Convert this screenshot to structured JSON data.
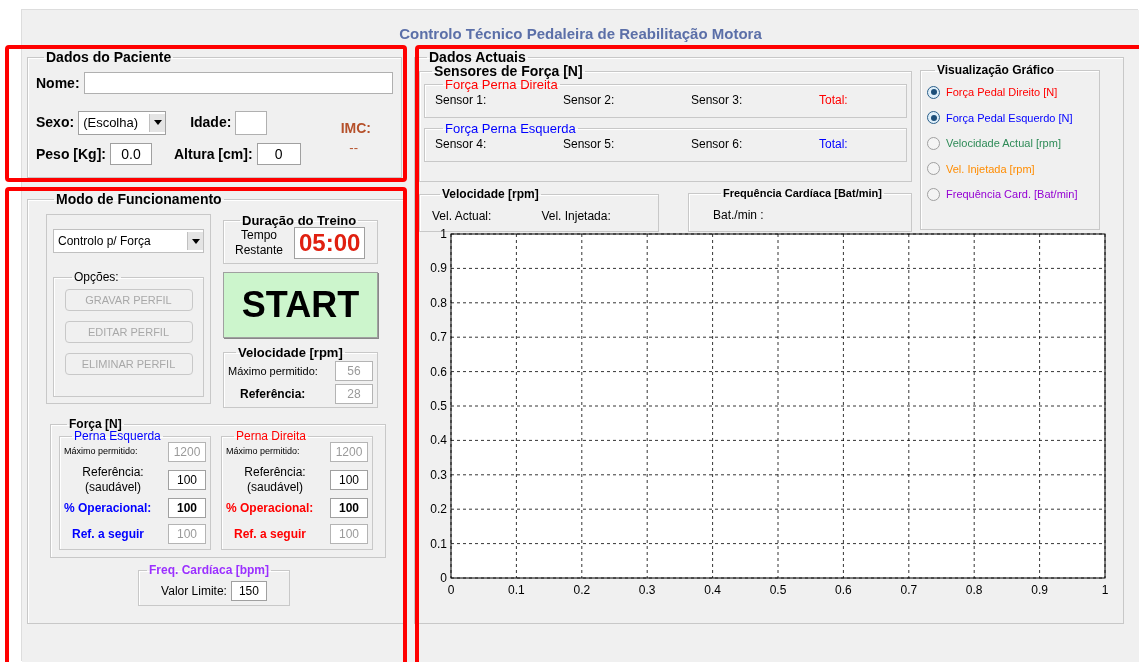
{
  "title": "Controlo Técnico Pedaleira de Reabilitação Motora",
  "patient": {
    "title": "Dados do Paciente",
    "name_label": "Nome:",
    "sex_label": "Sexo:",
    "sex_value": "(Escolha)",
    "age_label": "Idade:",
    "weight_label": "Peso [Kg]:",
    "weight_value": "0.0",
    "height_label": "Altura [cm]:",
    "height_value": "0",
    "imc_label": "IMC:",
    "imc_value": "--"
  },
  "mode": {
    "title": "Modo de Funcionamento",
    "control_mode": "Controlo p/ Força",
    "options": {
      "title": "Opções:",
      "buttons": [
        {
          "label": "GRAVAR PERFIL",
          "disabled": true
        },
        {
          "label": "EDITAR PERFIL",
          "disabled": true
        },
        {
          "label": "ELIMINAR PERFIL",
          "disabled": true
        }
      ]
    },
    "duration": {
      "title": "Duração do Treino",
      "label": "Tempo Restante",
      "time": "05:00"
    },
    "start": "START",
    "speed": {
      "title": "Velocidade [rpm]",
      "max_label": "Máximo permitido:",
      "max": {
        "value": "56",
        "disabled": true
      },
      "ref_label": "Referência:",
      "ref": {
        "value": "28",
        "disabled": true
      }
    },
    "force": {
      "title": "Força [N]",
      "legs": [
        {
          "title": "Perna Esquerda",
          "color": "#0000ff",
          "max_label": "Máximo permitido:",
          "max": {
            "value": "1200",
            "disabled": true
          },
          "ref_label": "Referência:",
          "ref_note": "(saudável)",
          "ref": {
            "value": "100",
            "disabled": false
          },
          "op_label": "% Operacional:",
          "op": {
            "value": "100",
            "disabled": false
          },
          "follow_label": "Ref. a seguir",
          "follow": {
            "value": "100",
            "disabled": true
          }
        },
        {
          "title": "Perna Direita",
          "color": "#ff0000",
          "max_label": "Máximo permitido:",
          "max": {
            "value": "1200",
            "disabled": true
          },
          "ref_label": "Referência:",
          "ref_note": "(saudável)",
          "ref": {
            "value": "100",
            "disabled": false
          },
          "op_label": "% Operacional:",
          "op": {
            "value": "100",
            "disabled": false
          },
          "follow_label": "Ref. a seguir",
          "follow": {
            "value": "100",
            "disabled": true
          }
        }
      ]
    },
    "heart": {
      "title": "Freq. Cardíaca [bpm]",
      "label": "Valor Limite:",
      "value": "150"
    }
  },
  "current": {
    "title": "Dados Actuais",
    "sensors": {
      "title": "Sensores de Força [N]",
      "groups": [
        {
          "title": "Força Perna Direita",
          "color": "#ff0000",
          "sensors": [
            "Sensor 1:",
            "Sensor 2:",
            "Sensor 3:"
          ],
          "total": "Total:"
        },
        {
          "title": "Força Perna Esquerda",
          "color": "#0000ff",
          "sensors": [
            "Sensor 4:",
            "Sensor 5:",
            "Sensor 6:"
          ],
          "total": "Total:"
        }
      ]
    },
    "speed": {
      "title": "Velocidade [rpm]",
      "labels": [
        "Vel. Actual:",
        "Vel. Injetada:"
      ]
    },
    "heart": {
      "title": "Frequência Cardíaca [Bat/min]",
      "label": "Bat./min :"
    },
    "view": {
      "title": "Visualização Gráfico",
      "items": [
        {
          "label": "Força Pedal Direito [N]",
          "color": "#ff0000",
          "selected": true
        },
        {
          "label": "Força Pedal Esquerdo [N]",
          "color": "#0000ff",
          "selected": true
        },
        {
          "label": "Velocidade Actual [rpm]",
          "color": "#2e8b57",
          "selected": false
        },
        {
          "label": "Vel. Injetada [rpm]",
          "color": "#ff8c00",
          "selected": false
        },
        {
          "label": "Frequência Card. [Bat/min]",
          "color": "#9400d3",
          "selected": false
        }
      ]
    },
    "chart_data": {
      "type": "line",
      "grid": true,
      "xlim": [
        0,
        1
      ],
      "ylim": [
        0,
        1
      ],
      "xticks": [
        0,
        0.1,
        0.2,
        0.3,
        0.4,
        0.5,
        0.6,
        0.7,
        0.8,
        0.9,
        1
      ],
      "yticks": [
        0,
        0.1,
        0.2,
        0.3,
        0.4,
        0.5,
        0.6,
        0.7,
        0.8,
        0.9,
        1
      ]
    }
  }
}
